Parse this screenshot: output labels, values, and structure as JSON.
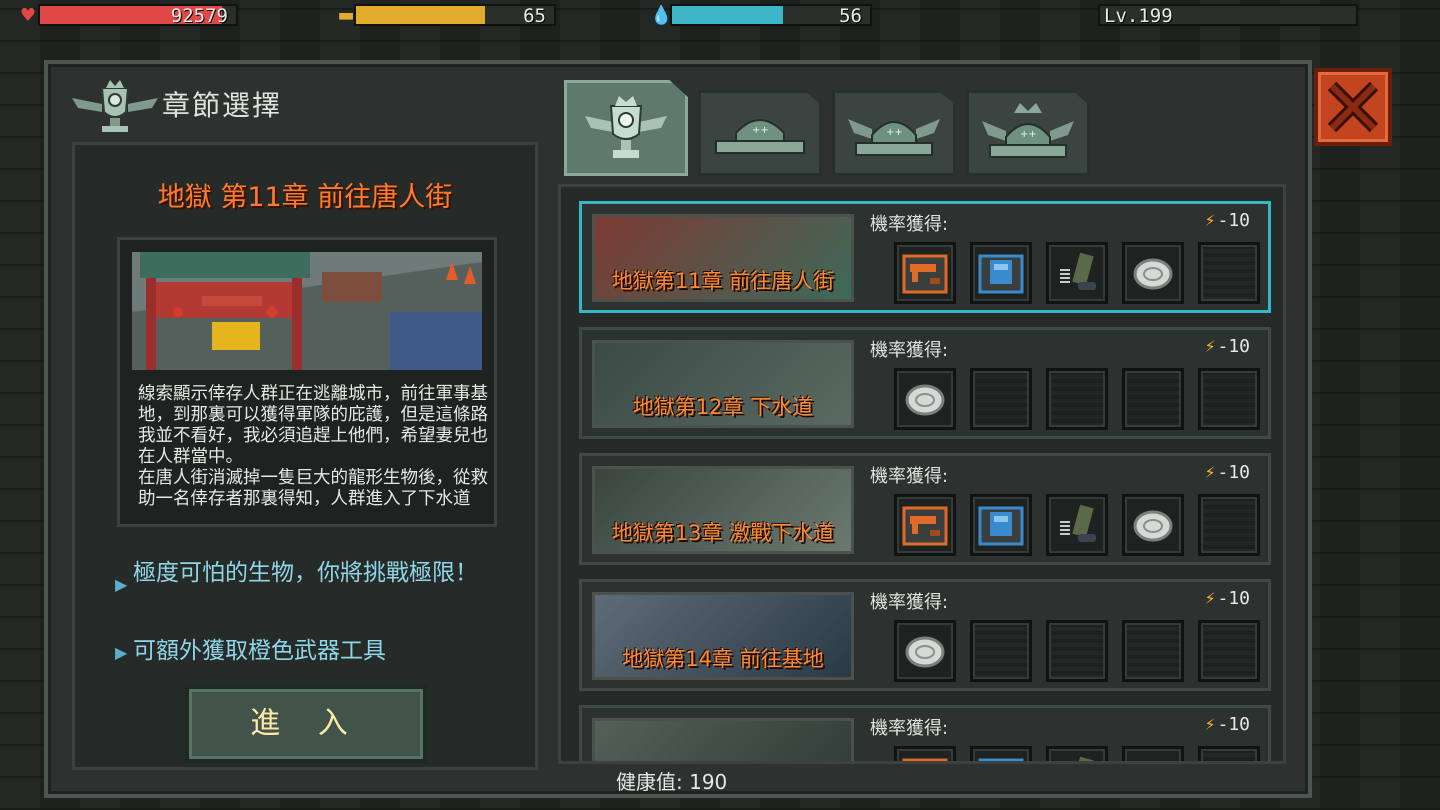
{
  "hud": {
    "hp": {
      "value": "92579",
      "fill": 0.93,
      "color": "#e04848",
      "icon": "heart-icon"
    },
    "food": {
      "value": "65",
      "fill": 0.65,
      "color": "#e2ab2c",
      "icon": "burger-icon"
    },
    "water": {
      "value": "56",
      "fill": 0.56,
      "color": "#3fb6c8",
      "icon": "water-drop-icon"
    },
    "level": {
      "value": "Lv.199",
      "fill": 0.0
    }
  },
  "panel": {
    "title": "章節選擇",
    "chapter_title": "地獄 第11章 前往唐人街",
    "description": "線索顯示倖存人群正在逃離城市，前往軍事基地，到那裏可以獲得軍隊的庇護，但是這條路我並不看好，我必須追趕上他們，希望妻兒也在人群當中。\n在唐人街消滅掉一隻巨大的龍形生物後，從救助一名倖存者那裏得知，人群進入了下水道",
    "perk_1": "極度可怕的生物，你將挑戰極限！",
    "perk_2": "可額外獲取橙色武器工具",
    "enter_label": "進 入",
    "health_label": "健康值: 190"
  },
  "tabs": [
    "trophy-tab",
    "helmet-tab-1",
    "helmet-tab-2",
    "helmet-tab-3"
  ],
  "chapters": [
    {
      "label": "地獄第11章 前往唐人街",
      "drop_label": "機率獲得:",
      "energy": "-10",
      "selected": true,
      "slots": [
        "orange-gun-case",
        "blue-armor-case",
        "green-spring-parts",
        "silver-coin",
        "empty"
      ]
    },
    {
      "label": "地獄第12章 下水道",
      "drop_label": "機率獲得:",
      "energy": "-10",
      "selected": false,
      "slots": [
        "silver-coin",
        "empty",
        "empty",
        "empty",
        "empty"
      ]
    },
    {
      "label": "地獄第13章 激戰下水道",
      "drop_label": "機率獲得:",
      "energy": "-10",
      "selected": false,
      "slots": [
        "orange-gun-case",
        "blue-armor-case",
        "green-spring-parts",
        "silver-coin",
        "empty"
      ]
    },
    {
      "label": "地獄第14章 前往基地",
      "drop_label": "機率獲得:",
      "energy": "-10",
      "selected": false,
      "slots": [
        "silver-coin",
        "empty",
        "empty",
        "empty",
        "empty"
      ]
    },
    {
      "label": "",
      "drop_label": "機率獲得:",
      "energy": "-10",
      "selected": false,
      "slots": [
        "orange-gun-case",
        "blue-armor-case",
        "green-spring-parts",
        "silver-coin",
        "empty"
      ]
    }
  ]
}
